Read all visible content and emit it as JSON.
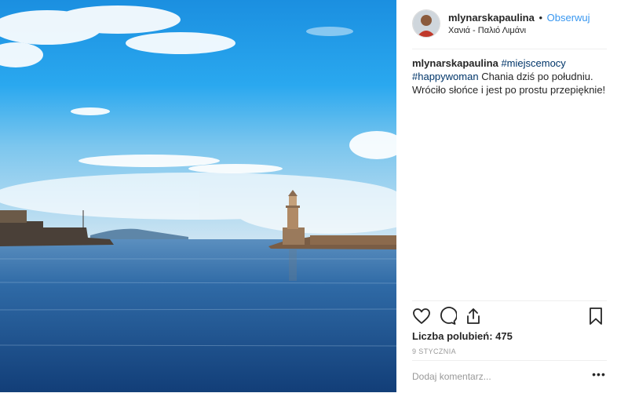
{
  "post": {
    "username": "mlynarskapaulina",
    "separator": "•",
    "follow_label": "Obserwuj",
    "location": "Χανιά - Παλιό Λιμάνι",
    "caption": {
      "username": "mlynarskapaulina",
      "hashtag1": "#miejscemocy",
      "hashtag2": "#happywoman",
      "text": "Chania dziś po południu. Wróciło słońce i jest po prostu przepięknie!"
    },
    "likes_text": "Liczba polubień: 475",
    "date": "9 stycznia",
    "comment_placeholder": "Dodaj komentarz...",
    "more_label": "•••"
  },
  "icons": {
    "like": "heart-icon",
    "comment": "comment-bubble-icon",
    "share": "share-icon",
    "save": "bookmark-icon"
  },
  "colors": {
    "follow": "#3897f0",
    "hashtag": "#003569",
    "sky": "#1e9ee8",
    "sea": "#1d5c98"
  }
}
